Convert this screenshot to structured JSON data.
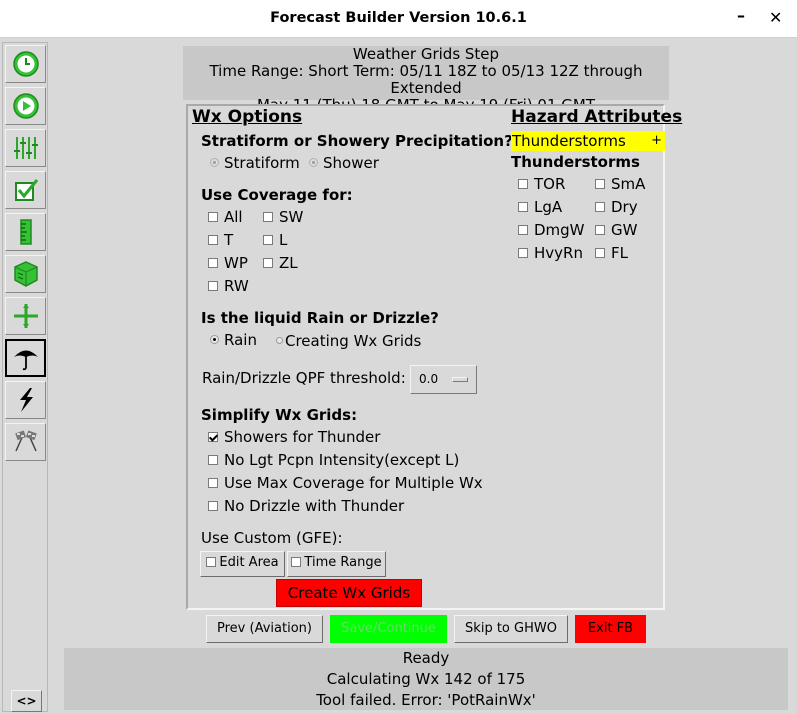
{
  "window": {
    "title": "Forecast Builder Version 10.6.1",
    "minimize_glyph": "–",
    "close_glyph": "✕"
  },
  "toolbar": {
    "buttons": [
      {
        "icon": "clock-icon",
        "color": "#30b030"
      },
      {
        "icon": "play-icon",
        "color": "#30b030"
      },
      {
        "icon": "sliders-icon",
        "color": "#30b030"
      },
      {
        "icon": "checkbox-icon",
        "color": "#30b030"
      },
      {
        "icon": "ruler-icon",
        "color": "#30b030"
      },
      {
        "icon": "cube-icon",
        "color": "#30b030"
      },
      {
        "icon": "crosshair-icon",
        "color": "#30b030"
      },
      {
        "icon": "umbrella-icon",
        "color": "#000000",
        "active": true
      },
      {
        "icon": "lightning-icon",
        "color": "#000000"
      },
      {
        "icon": "checkered-flags-icon",
        "color": "#000000"
      }
    ],
    "toggle_label": "<>"
  },
  "step_header": {
    "line1": "Weather Grids Step",
    "line2": "Time Range:  Short Term: 05/11 18Z to 05/13 12Z through Extended",
    "line3": "May 11 (Thu) 18 GMT to May 19 (Fri) 01 GMT"
  },
  "wx_options": {
    "title": "Wx Options",
    "precip_question": "Stratiform or Showery Precipitation?",
    "precip_options": [
      "Stratiform",
      "Shower"
    ],
    "coverage_label": "Use Coverage for:",
    "coverage_options": [
      {
        "label": "All",
        "checked": false
      },
      {
        "label": "SW",
        "checked": false
      },
      {
        "label": "T",
        "checked": false
      },
      {
        "label": "L",
        "checked": false
      },
      {
        "label": "WP",
        "checked": false
      },
      {
        "label": "ZL",
        "checked": false
      },
      {
        "label": "RW",
        "checked": false
      }
    ],
    "liquid_question": "Is the liquid Rain or Drizzle?",
    "liquid_options": [
      {
        "label": "Rain",
        "selected": true
      },
      {
        "label": "Creating Wx Grids",
        "selected": false
      }
    ],
    "qpf_label": "Rain/Drizzle QPF threshold:",
    "qpf_value": "0.0",
    "simplify_label": "Simplify Wx Grids:",
    "simplify_options": [
      {
        "label": "Showers for Thunder",
        "checked": true
      },
      {
        "label": "No Lgt Pcpn Intensity(except L)",
        "checked": false
      },
      {
        "label": "Use Max Coverage for Multiple Wx",
        "checked": false
      },
      {
        "label": "No Drizzle with Thunder",
        "checked": false
      }
    ],
    "custom_label": "Use Custom (GFE):",
    "edit_area_label": "Edit Area",
    "time_range_label": "Time Range",
    "create_label": "Create Wx Grids"
  },
  "hazard_attributes": {
    "title": "Hazard Attributes",
    "selected": "Thunderstorms",
    "expand_glyph": "+",
    "group_label": "Thunderstorms",
    "options": [
      {
        "label": "TOR",
        "checked": false
      },
      {
        "label": "SmA",
        "checked": false
      },
      {
        "label": "LgA",
        "checked": false
      },
      {
        "label": "Dry",
        "checked": false
      },
      {
        "label": "DmgW",
        "checked": false
      },
      {
        "label": "GW",
        "checked": false
      },
      {
        "label": "HvyRn",
        "checked": false
      },
      {
        "label": "FL",
        "checked": false
      }
    ]
  },
  "bottom_buttons": {
    "prev": "Prev (Aviation)",
    "save": "Save/Continue",
    "skip": "Skip to GHWO",
    "exit": "Exit FB"
  },
  "colors": {
    "save_bg": "#00ff00",
    "save_text": "#6ad86a",
    "exit_bg": "#ff0000",
    "hazard_highlight": "#ffff00",
    "create_bg": "#ff0000"
  },
  "status": {
    "line1": "Ready",
    "line2": "Calculating Wx 142 of 175",
    "line3": "Tool failed. Error: 'PotRainWx'"
  }
}
